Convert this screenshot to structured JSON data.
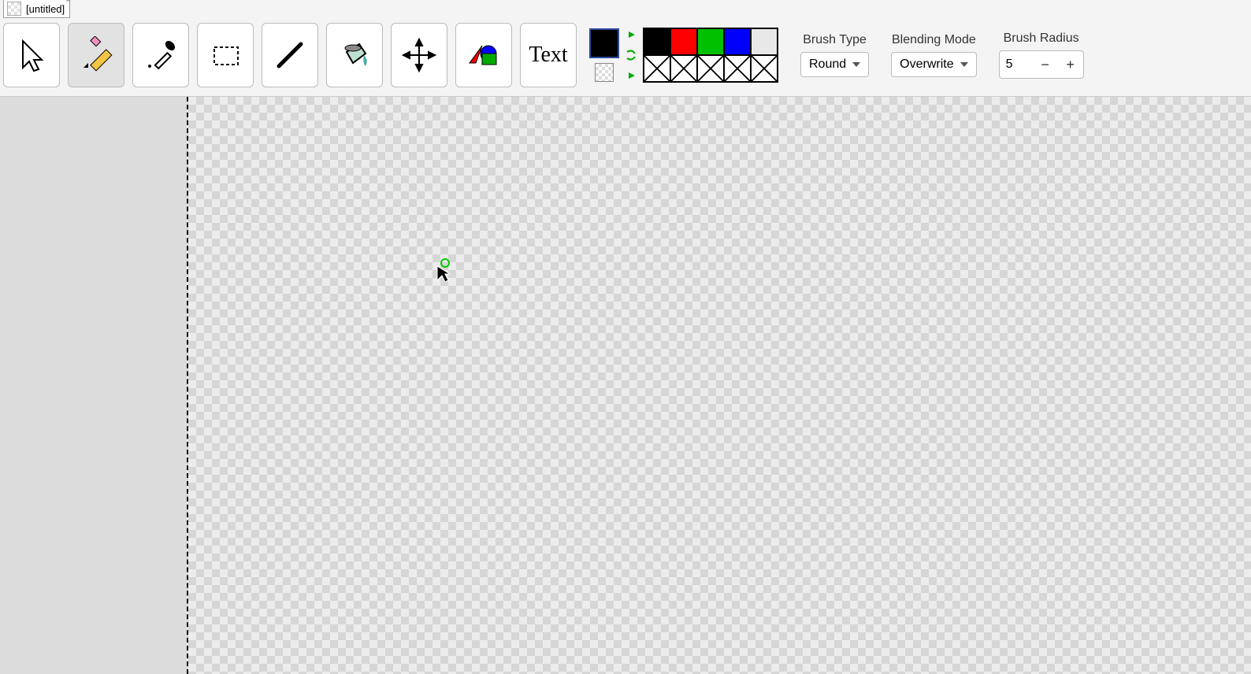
{
  "tab": {
    "title": "[untitled]"
  },
  "tools": {
    "text_label": "Text"
  },
  "palette": {
    "row1": [
      "#000000",
      "#ff0000",
      "#00c000",
      "#0000ff",
      "#e8e8e8"
    ]
  },
  "brush_type": {
    "label": "Brush Type",
    "value": "Round"
  },
  "blending_mode": {
    "label": "Blending Mode",
    "value": "Overwrite"
  },
  "brush_radius": {
    "label": "Brush Radius",
    "value": "5"
  }
}
